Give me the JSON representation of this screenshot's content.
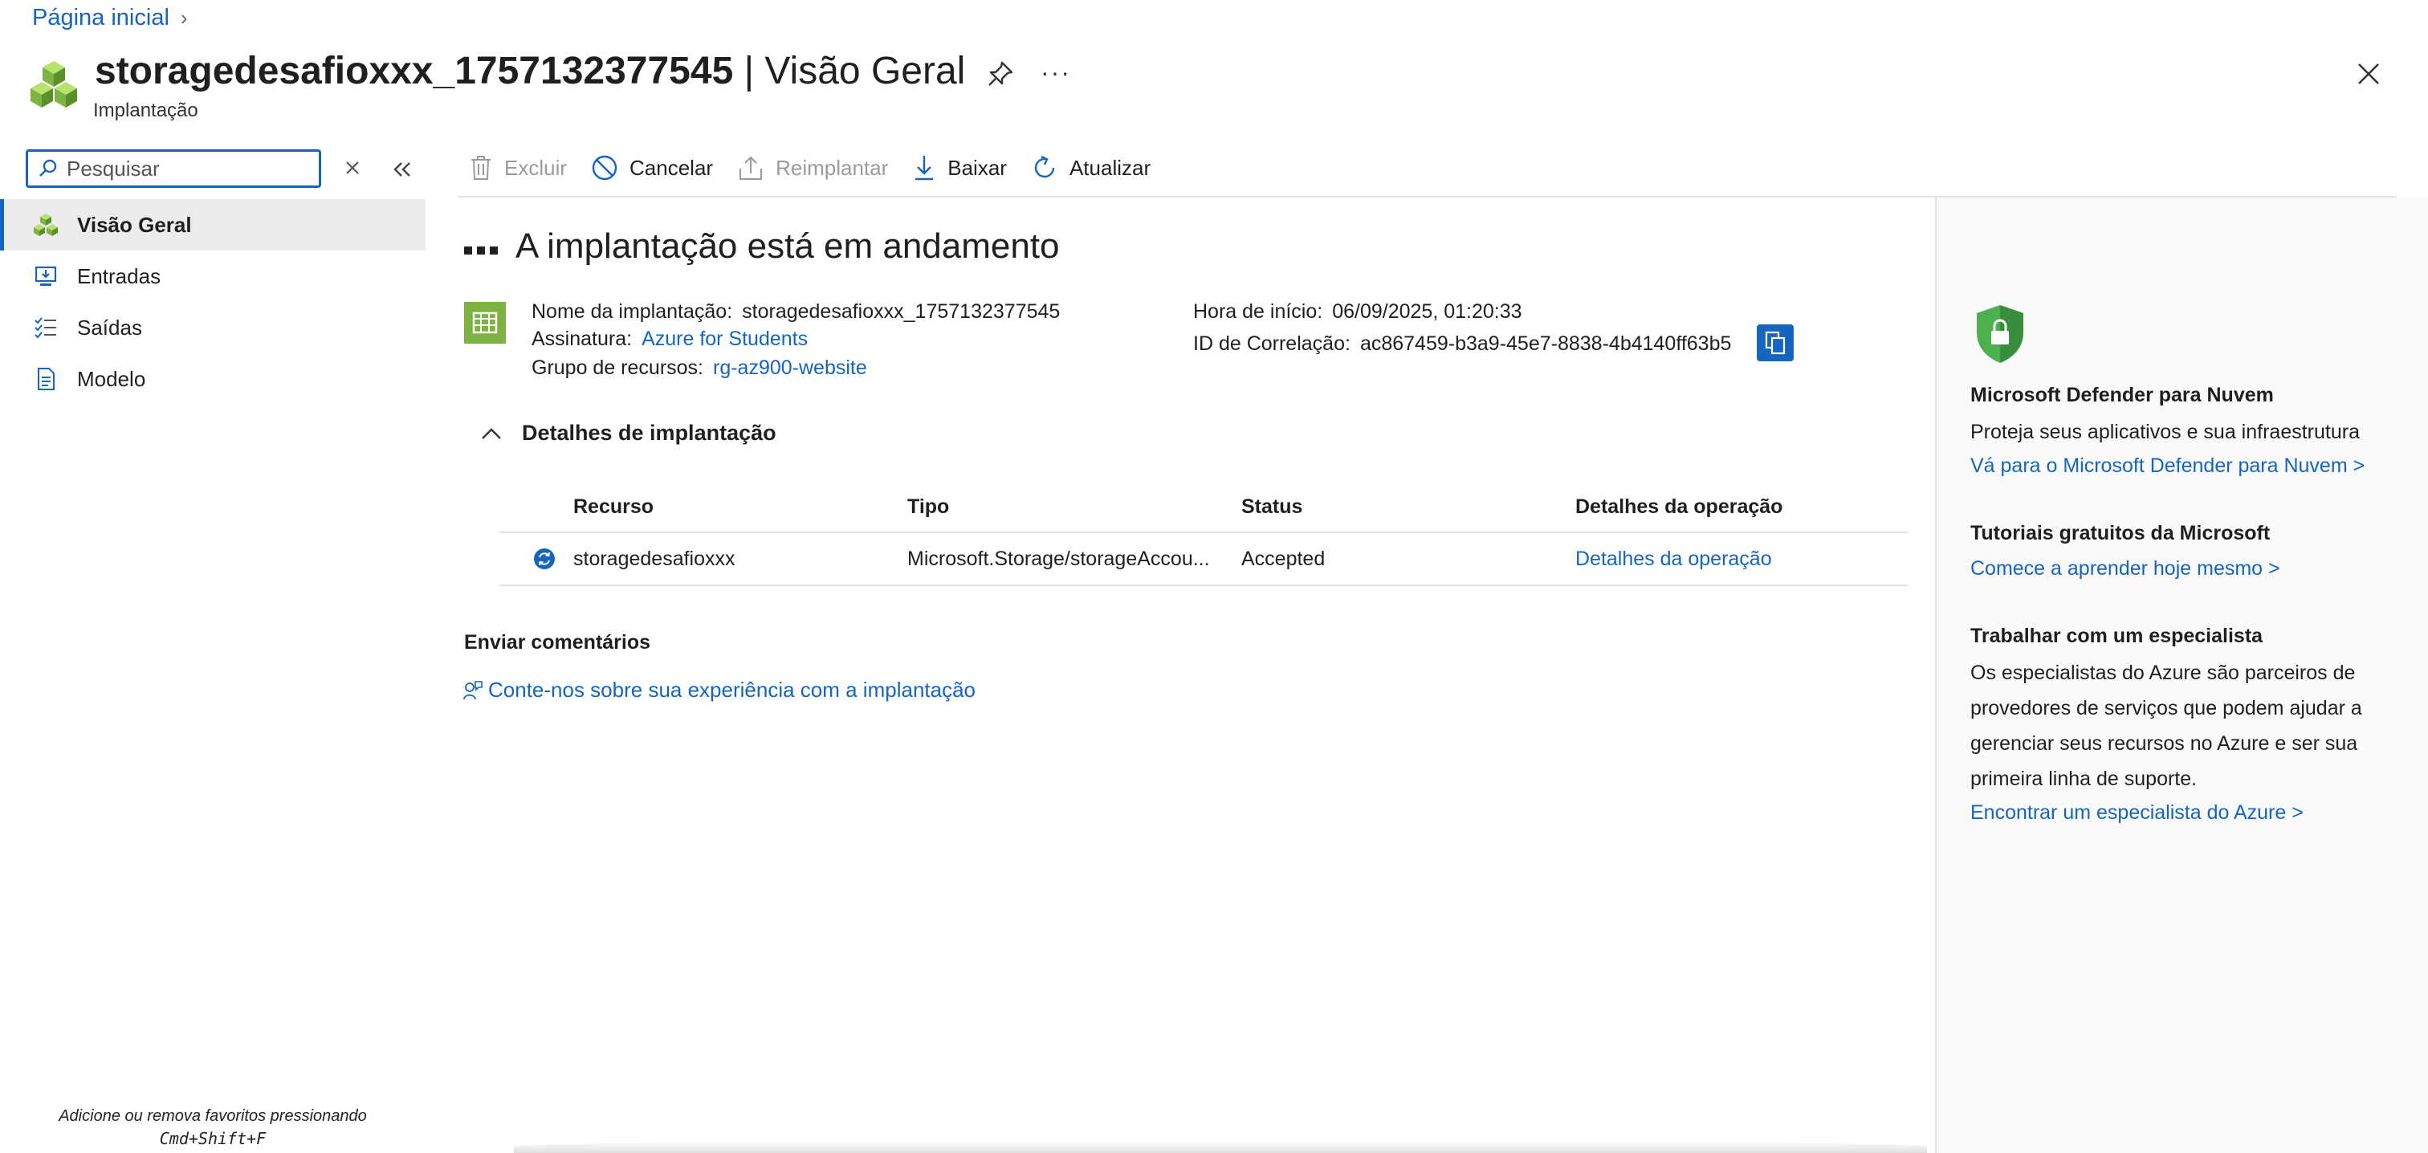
{
  "breadcrumb": {
    "home": "Página inicial"
  },
  "header": {
    "title_main": "storagedesafioxxx_1757132377545",
    "title_sep": " | ",
    "title_section": "Visão Geral",
    "subtitle": "Implantação",
    "more": "···"
  },
  "search": {
    "placeholder": "Pesquisar"
  },
  "nav": {
    "items": [
      {
        "label": "Visão Geral",
        "icon": "overview-cubes-icon"
      },
      {
        "label": "Entradas",
        "icon": "inputs-icon"
      },
      {
        "label": "Saídas",
        "icon": "outputs-list-icon"
      },
      {
        "label": "Modelo",
        "icon": "template-document-icon"
      }
    ]
  },
  "footer_hint": {
    "line1": "Adicione ou remova favoritos pressionando",
    "line2": "Cmd+Shift+F"
  },
  "toolbar": {
    "delete": "Excluir",
    "cancel": "Cancelar",
    "redeploy": "Reimplantar",
    "download": "Baixar",
    "refresh": "Atualizar"
  },
  "status": {
    "title": "A implantação está em andamento"
  },
  "info": {
    "deployment_name_label": "Nome da implantação:",
    "deployment_name": "storagedesafioxxx_1757132377545",
    "subscription_label": "Assinatura:",
    "subscription": "Azure for Students",
    "resource_group_label": "Grupo de recursos:",
    "resource_group": "rg-az900-website",
    "start_time_label": "Hora de início:",
    "start_time": "06/09/2025, 01:20:33",
    "correlation_label": "ID de Correlação:",
    "correlation_id": "ac867459-b3a9-45e7-8838-4b4140ff63b5"
  },
  "details": {
    "toggle_label": "Detalhes de implantação",
    "columns": [
      "Recurso",
      "Tipo",
      "Status",
      "Detalhes da operação"
    ],
    "rows": [
      {
        "resource": "storagedesafioxxx",
        "type": "Microsoft.Storage/storageAccou...",
        "status": "Accepted",
        "details": "Detalhes da operação"
      }
    ]
  },
  "feedback": {
    "heading": "Enviar comentários",
    "link": "Conte-nos sobre sua experiência com a implantação"
  },
  "right_panel": {
    "defender_title": "Microsoft Defender para Nuvem",
    "defender_text": "Proteja seus aplicativos e sua infraestrutura",
    "defender_link": "Vá para o Microsoft Defender para Nuvem >",
    "tutorials_title": "Tutoriais gratuitos da Microsoft",
    "tutorials_link": "Comece a aprender hoje mesmo >",
    "expert_title": "Trabalhar com um especialista",
    "expert_text": "Os especialistas do Azure são parceiros de provedores de serviços que podem ajudar a gerenciar seus recursos no Azure e ser sua primeira linha de suporte.",
    "expert_link": "Encontrar um especialista do Azure >"
  },
  "colors": {
    "accent": "#1565c0",
    "green": "#7cb342",
    "shield": "#4caf50"
  }
}
